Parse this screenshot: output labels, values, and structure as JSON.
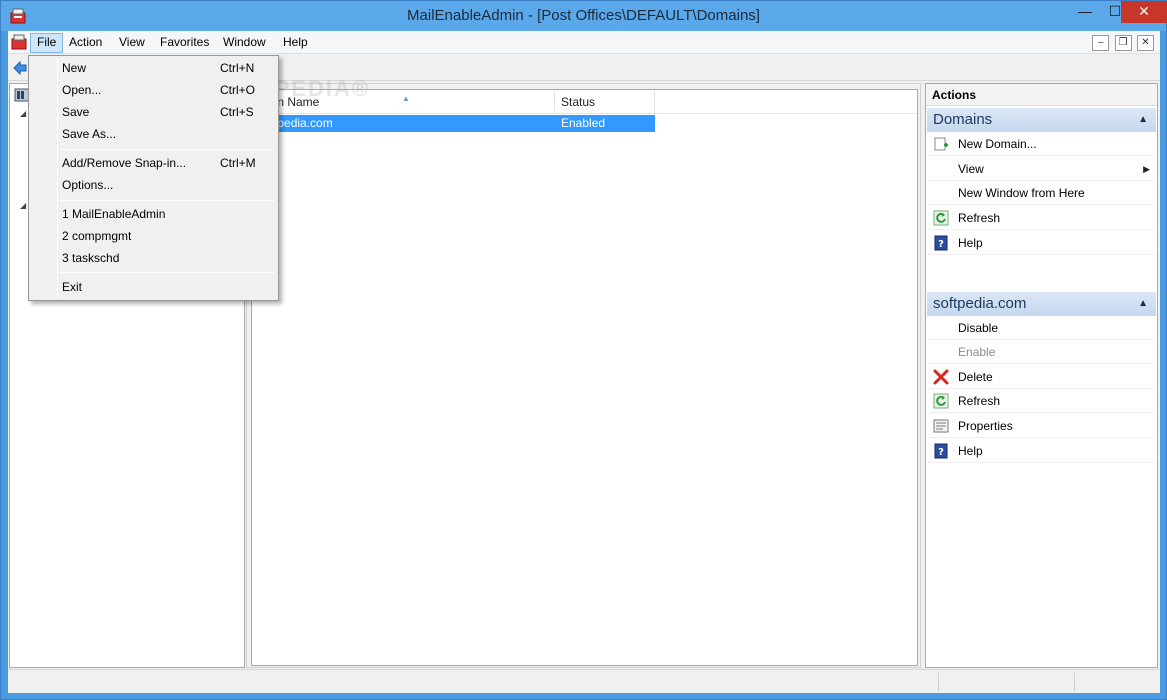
{
  "window": {
    "title": "MailEnableAdmin - [Post Offices\\DEFAULT\\Domains]",
    "controls": {
      "minimize": "—",
      "maximize": "☐",
      "close": "✕"
    }
  },
  "menubar": {
    "items": [
      "File",
      "Action",
      "View",
      "Favorites",
      "Window",
      "Help"
    ],
    "active": "File"
  },
  "mdi_controls": {
    "minimize": "–",
    "restore": "❐",
    "close": "✕"
  },
  "file_menu": {
    "items": [
      {
        "label": "New",
        "shortcut": "Ctrl+N"
      },
      {
        "label": "Open...",
        "shortcut": "Ctrl+O"
      },
      {
        "label": "Save",
        "shortcut": "Ctrl+S"
      },
      {
        "label": "Save As...",
        "shortcut": ""
      },
      {
        "label": "Add/Remove Snap-in...",
        "shortcut": "Ctrl+M"
      },
      {
        "label": "Options...",
        "shortcut": ""
      },
      {
        "label": "1 MailEnableAdmin",
        "shortcut": ""
      },
      {
        "label": "2 compmgmt",
        "shortcut": ""
      },
      {
        "label": "3 taskschd",
        "shortcut": ""
      },
      {
        "label": "Exit",
        "shortcut": ""
      }
    ]
  },
  "list": {
    "columns": [
      "main Name",
      "Status"
    ],
    "rows": [
      {
        "name": "softpedia.com",
        "status": "Enabled",
        "selected": true
      }
    ]
  },
  "actions": {
    "title": "Actions",
    "sections": [
      {
        "header": "Domains",
        "items": [
          {
            "label": "New Domain...",
            "icon": "new-domain-icon",
            "enabled": true
          },
          {
            "label": "View",
            "icon": "",
            "enabled": true,
            "submenu": true
          },
          {
            "label": "New Window from Here",
            "icon": "",
            "enabled": true
          },
          {
            "label": "Refresh",
            "icon": "refresh-icon",
            "enabled": true
          },
          {
            "label": "Help",
            "icon": "help-icon",
            "enabled": true
          }
        ]
      },
      {
        "header": "softpedia.com",
        "items": [
          {
            "label": "Disable",
            "icon": "",
            "enabled": true
          },
          {
            "label": "Enable",
            "icon": "",
            "enabled": false
          },
          {
            "label": "Delete",
            "icon": "delete-icon",
            "enabled": true
          },
          {
            "label": "Refresh",
            "icon": "refresh-icon",
            "enabled": true
          },
          {
            "label": "Properties",
            "icon": "properties-icon",
            "enabled": true
          },
          {
            "label": "Help",
            "icon": "help-icon",
            "enabled": true
          }
        ]
      }
    ]
  },
  "watermark": "SOFTPEDIA®",
  "colors": {
    "selection": "#3399ff",
    "title_bar": "#5aa8ea",
    "close_button": "#c7352b",
    "section_header": "#c5d7ee",
    "delete_red": "#d9261c",
    "refresh_green": "#2e9b3a",
    "help_blue": "#2b4fa0"
  }
}
